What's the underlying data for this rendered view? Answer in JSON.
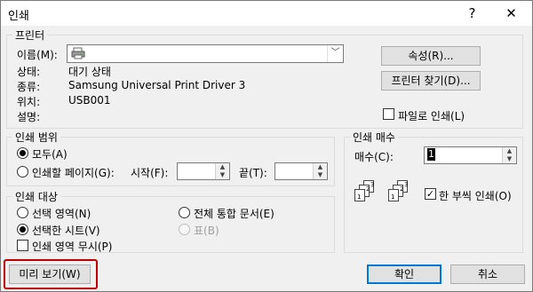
{
  "window": {
    "title": "인쇄",
    "help": "?",
    "close": "✕"
  },
  "printer": {
    "group_label": "프린터",
    "name_label": "이름(M):",
    "name_value": "",
    "status_label": "상태:",
    "status_value": "대기 상태",
    "type_label": "종류:",
    "type_value": "Samsung Universal Print Driver 3",
    "where_label": "위치:",
    "where_value": "USB001",
    "comment_label": "설명:",
    "properties_button": "속성(R)...",
    "find_printer_button": "프린터 찾기(D)...",
    "print_to_file_label": "파일로 인쇄(L)"
  },
  "print_range": {
    "group_label": "인쇄 범위",
    "all_label": "모두(A)",
    "pages_label": "인쇄할 페이지(G):",
    "start_label": "시작(F):",
    "end_label": "끝(T):",
    "start_value": "",
    "end_value": ""
  },
  "print_what": {
    "group_label": "인쇄 대상",
    "selection_label": "선택 영역(N)",
    "active_sheets_label": "선택한 시트(V)",
    "entire_workbook_label": "전체 통합 문서(E)",
    "table_label": "표(B)",
    "ignore_print_areas_label": "인쇄 영역 무시(P)"
  },
  "copies": {
    "group_label": "인쇄 매수",
    "count_label": "매수(C):",
    "count_value": "1",
    "collate_label": "한 부씩 인쇄(O)"
  },
  "footer": {
    "preview_button": "미리 보기(W)",
    "ok_button": "확인",
    "cancel_button": "취소"
  }
}
